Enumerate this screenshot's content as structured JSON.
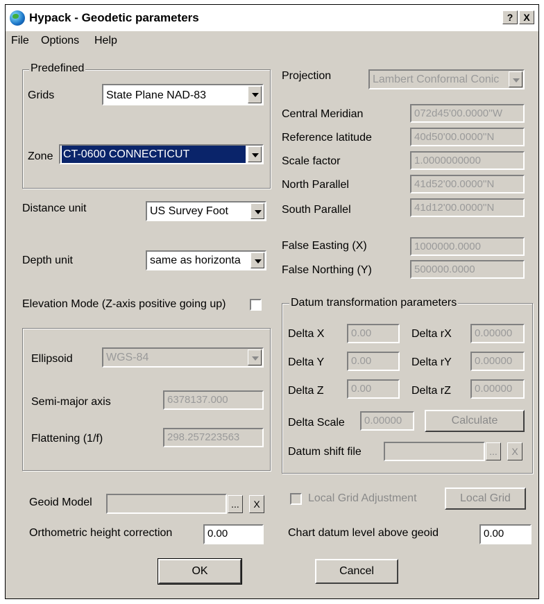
{
  "window": {
    "title": "Hypack - Geodetic parameters",
    "help_btn": "?",
    "close_btn": "X"
  },
  "menu": {
    "file": "File",
    "options": "Options",
    "help": "Help"
  },
  "predefined": {
    "group_title": "Predefined",
    "grids_label": "Grids",
    "grids_value": "State Plane NAD-83",
    "zone_label": "Zone",
    "zone_value": "CT-0600 CONNECTICUT"
  },
  "units": {
    "distance_label": "Distance unit",
    "distance_value": "US Survey Foot",
    "depth_label": "Depth unit",
    "depth_value": "same as horizonta"
  },
  "elevation": {
    "label": "Elevation Mode (Z-axis positive going up)",
    "checked": false
  },
  "ellipsoid": {
    "label": "Ellipsoid",
    "value": "WGS-84",
    "semi_major_label": "Semi-major axis",
    "semi_major_value": "6378137.000",
    "flattening_label": "Flattening (1/f)",
    "flattening_value": "298.257223563"
  },
  "projection": {
    "label": "Projection",
    "value": "Lambert Conformal Conic",
    "central_meridian_label": "Central Meridian",
    "central_meridian_value": "072d45'00.0000''W",
    "reference_latitude_label": "Reference latitude",
    "reference_latitude_value": "40d50'00.0000''N",
    "scale_factor_label": "Scale factor",
    "scale_factor_value": "1.0000000000",
    "north_parallel_label": "North Parallel",
    "north_parallel_value": "41d52'00.0000''N",
    "south_parallel_label": "South Parallel",
    "south_parallel_value": "41d12'00.0000''N",
    "false_easting_label": "False Easting (X)",
    "false_easting_value": "1000000.0000",
    "false_northing_label": "False Northing (Y)",
    "false_northing_value": "500000.0000"
  },
  "datum": {
    "group_title": "Datum transformation parameters",
    "delta_x_label": "Delta X",
    "delta_x_value": "0.00",
    "delta_y_label": "Delta Y",
    "delta_y_value": "0.00",
    "delta_z_label": "Delta Z",
    "delta_z_value": "0.00",
    "delta_rx_label": "Delta rX",
    "delta_rx_value": "0.00000",
    "delta_ry_label": "Delta rY",
    "delta_ry_value": "0.00000",
    "delta_rz_label": "Delta rZ",
    "delta_rz_value": "0.00000",
    "delta_scale_label": "Delta Scale",
    "delta_scale_value": "0.00000",
    "calculate_label": "Calculate",
    "shift_file_label": "Datum shift file",
    "browse_label": "...",
    "clear_label": "X"
  },
  "geoid": {
    "label": "Geoid Model",
    "browse_label": "...",
    "clear_label": "X",
    "local_grid_adjustment_label": "Local Grid Adjustment",
    "local_grid_button": "Local Grid",
    "orthometric_label": "Orthometric height correction",
    "orthometric_value": "0.00",
    "chart_datum_label": "Chart datum level above geoid",
    "chart_datum_value": "0.00"
  },
  "buttons": {
    "ok": "OK",
    "cancel": "Cancel"
  }
}
